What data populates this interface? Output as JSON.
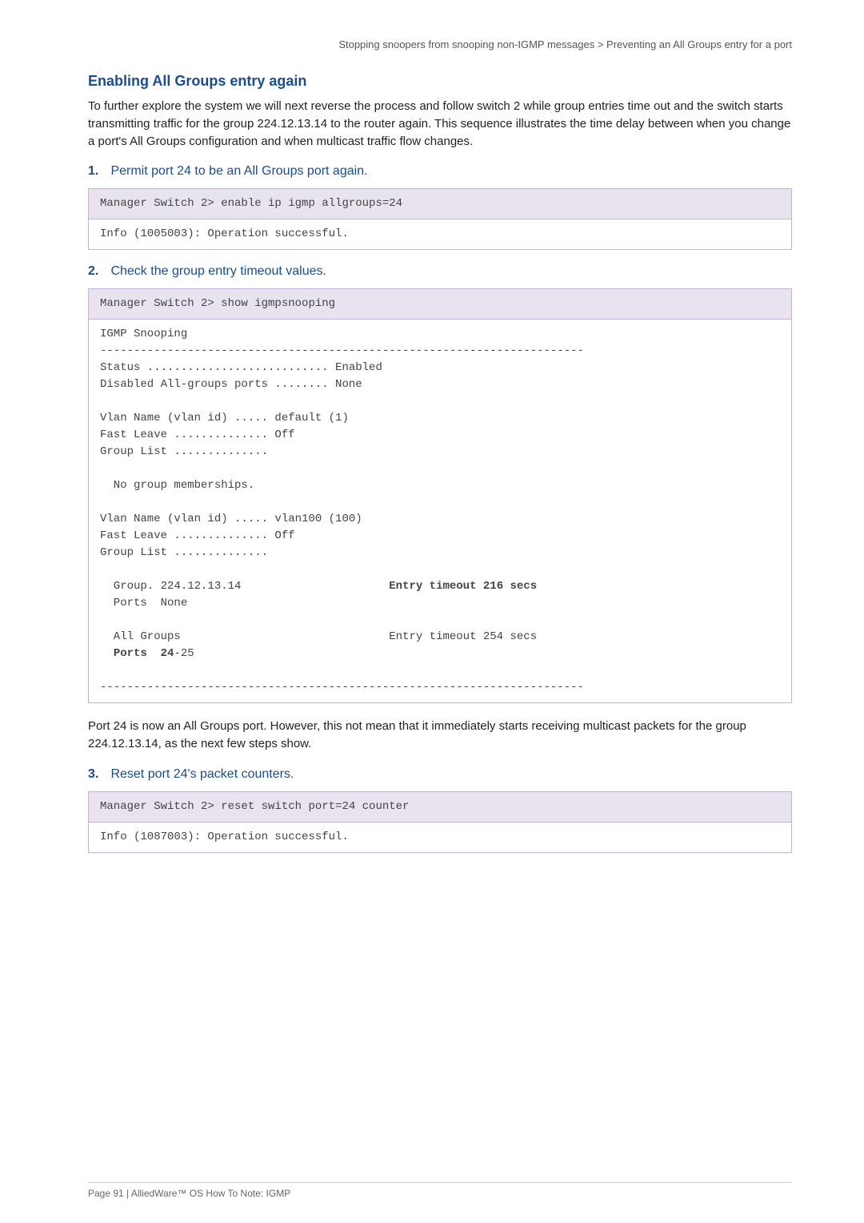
{
  "header": {
    "breadcrumb_left": "Stopping snoopers from snooping non-IGMP messages",
    "breadcrumb_sep": " > ",
    "breadcrumb_right": "Preventing an All Groups entry for a port"
  },
  "section_title": "Enabling All Groups entry again",
  "intro_para": "To further explore the system we will next reverse the process and follow switch 2 while group entries time out and the switch starts transmitting traffic for the group 224.12.13.14 to the router again. This sequence illustrates the time delay between when you change a port's All Groups configuration and when multicast traffic flow changes.",
  "steps": {
    "s1": {
      "num": "1.",
      "text": "Permit port 24 to be an All Groups port again."
    },
    "s2": {
      "num": "2.",
      "text": "Check the group entry timeout values."
    },
    "s3": {
      "num": "3.",
      "text": "Reset port 24's packet counters."
    }
  },
  "code1": {
    "cmd": "Manager Switch 2> enable ip igmp allgroups=24",
    "out": "Info (1005003): Operation successful."
  },
  "code2": {
    "cmd": "Manager Switch 2> show igmpsnooping",
    "out_pre1": "IGMP Snooping\n------------------------------------------------------------------------\nStatus ........................... Enabled\nDisabled All-groups ports ........ None\n\nVlan Name (vlan id) ..... default (1)\nFast Leave .............. Off\nGroup List ..............\n\n  No group memberships.\n\nVlan Name (vlan id) ..... vlan100 (100)\nFast Leave .............. Off\nGroup List ..............\n",
    "group_line_left": "  Group. 224.12.13.14                      ",
    "group_line_bold": "Entry timeout 216 secs",
    "ports_none": "  Ports  None\n",
    "all_groups_line": "  All Groups                               Entry timeout 254 secs",
    "ports_bold_left": "  ",
    "ports_bold": "Ports  24",
    "ports_bold_rest": "-25",
    "out_tail": "\n------------------------------------------------------------------------"
  },
  "mid_para": "Port 24 is now an All Groups port. However, this not mean that it immediately starts receiving multicast packets for the group 224.12.13.14, as the next few steps show.",
  "code3": {
    "cmd": "Manager Switch 2> reset switch port=24 counter",
    "out": "Info (1087003): Operation successful."
  },
  "footer": "Page 91 | AlliedWare™ OS How To Note: IGMP"
}
